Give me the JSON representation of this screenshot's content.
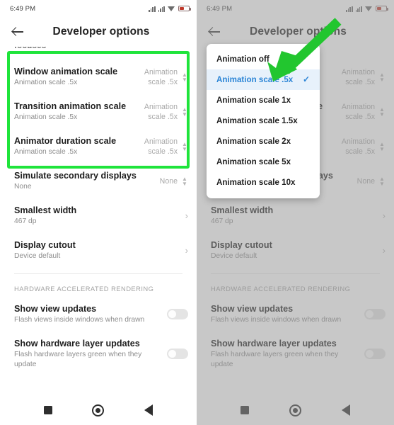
{
  "status_bar": {
    "time": "6:49 PM",
    "icons": [
      "signal-bars-icon",
      "signal-bars-icon",
      "wifi-icon",
      "battery-icon"
    ]
  },
  "app_bar": {
    "back_icon": "back-arrow-icon",
    "title": "Developer options"
  },
  "scrolled_fragment": "focuses",
  "colors": {
    "highlight_green": "#1fe43b",
    "arrow_green": "#22c62f",
    "selected_blue": "#2c85d6",
    "selected_row_bg": "#e7f1fb",
    "title_text": "#1f1f1f",
    "secondary_text": "#8d8d8d",
    "value_text": "#a8a8a8"
  },
  "settings_rows": [
    {
      "title": "Window animation scale",
      "subtitle": "Animation scale .5x",
      "value": "Animation scale .5x",
      "control": "spinner",
      "highlighted": true
    },
    {
      "title": "Transition animation scale",
      "subtitle": "Animation scale .5x",
      "value": "Animation scale .5x",
      "control": "spinner",
      "highlighted": true
    },
    {
      "title": "Animator duration scale",
      "subtitle": "Animation scale .5x",
      "value": "Animation scale .5x",
      "control": "spinner",
      "highlighted": true
    },
    {
      "title": "Simulate secondary displays",
      "subtitle": "None",
      "value": "None",
      "control": "spinner",
      "highlighted": false
    },
    {
      "title": "Smallest width",
      "subtitle": "467 dp",
      "value": "",
      "control": "chevron",
      "highlighted": false
    },
    {
      "title": "Display cutout",
      "subtitle": "Device default",
      "value": "",
      "control": "chevron",
      "highlighted": false
    }
  ],
  "section": {
    "header": "HARDWARE ACCELERATED RENDERING",
    "rows": [
      {
        "title": "Show view updates",
        "subtitle": "Flash views inside windows when drawn",
        "control": "toggle",
        "toggle_on": false
      },
      {
        "title": "Show hardware layer updates",
        "subtitle": "Flash hardware layers green when they update",
        "control": "toggle",
        "toggle_on": false
      }
    ]
  },
  "dialog": {
    "options": [
      {
        "label": "Animation off",
        "selected": false
      },
      {
        "label": "Animation scale .5x",
        "selected": true
      },
      {
        "label": "Animation scale 1x",
        "selected": false
      },
      {
        "label": "Animation scale 1.5x",
        "selected": false
      },
      {
        "label": "Animation scale 2x",
        "selected": false
      },
      {
        "label": "Animation scale 5x",
        "selected": false
      },
      {
        "label": "Animation scale 10x",
        "selected": false
      }
    ],
    "check_glyph": "✓"
  },
  "nav_bar": {
    "items": [
      "recents-square-icon",
      "home-circle-icon",
      "back-triangle-icon"
    ]
  },
  "spinner_glyph_up": "⌃",
  "spinner_glyph_down": "⌄",
  "chevron_glyph": "›"
}
